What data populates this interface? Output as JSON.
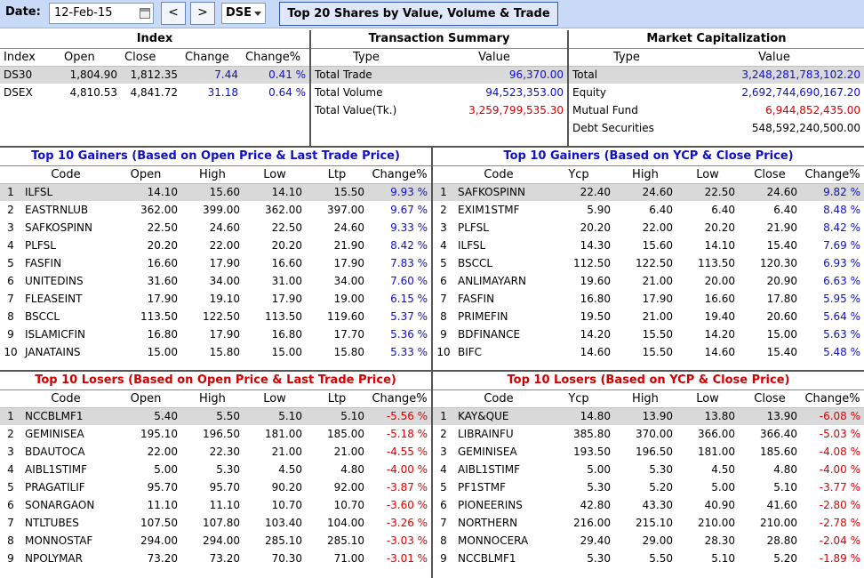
{
  "toolbar": {
    "date_label": "Date:",
    "date_value": "12-Feb-15",
    "prev_label": "<",
    "next_label": ">",
    "exchange": "DSE",
    "title": "Top 20 Shares by Value, Volume & Trade"
  },
  "index": {
    "title": "Index",
    "headers": [
      "Index",
      "Open",
      "Close",
      "Change",
      "Change%"
    ],
    "rows": [
      [
        "DS30",
        "1,804.90",
        "1,812.35",
        "7.44",
        "0.41 %"
      ],
      [
        "DSEX",
        "4,810.53",
        "4,841.72",
        "31.18",
        "0.64 %"
      ]
    ]
  },
  "transaction": {
    "title": "Transaction Summary",
    "headers": [
      "Type",
      "Value"
    ],
    "rows": [
      [
        "Total Trade",
        "96,370.00"
      ],
      [
        "Total Volume",
        "94,523,353.00"
      ],
      [
        "Total Value(Tk.)",
        "3,259,799,535.30"
      ]
    ]
  },
  "market_cap": {
    "title": "Market Capitalization",
    "headers": [
      "Type",
      "Value"
    ],
    "rows": [
      [
        "Total",
        "3,248,281,783,102.20"
      ],
      [
        "Equity",
        "2,692,744,690,167.20"
      ],
      [
        "Mutual Fund",
        "6,944,852,435.00"
      ],
      [
        "Debt Securities",
        "548,592,240,500.00"
      ]
    ]
  },
  "gainers_open": {
    "title": "Top 10 Gainers (Based on Open Price & Last Trade Price)",
    "headers": [
      "Code",
      "Open",
      "High",
      "Low",
      "Ltp",
      "Change%"
    ],
    "rows": [
      [
        "1",
        "ILFSL",
        "14.10",
        "15.60",
        "14.10",
        "15.50",
        "9.93 %"
      ],
      [
        "2",
        "EASTRNLUB",
        "362.00",
        "399.00",
        "362.00",
        "397.00",
        "9.67 %"
      ],
      [
        "3",
        "SAFKOSPINN",
        "22.50",
        "24.60",
        "22.50",
        "24.60",
        "9.33 %"
      ],
      [
        "4",
        "PLFSL",
        "20.20",
        "22.00",
        "20.20",
        "21.90",
        "8.42 %"
      ],
      [
        "5",
        "FASFIN",
        "16.60",
        "17.90",
        "16.60",
        "17.90",
        "7.83 %"
      ],
      [
        "6",
        "UNITEDINS",
        "31.60",
        "34.00",
        "31.00",
        "34.00",
        "7.60 %"
      ],
      [
        "7",
        "FLEASEINT",
        "17.90",
        "19.10",
        "17.90",
        "19.00",
        "6.15 %"
      ],
      [
        "8",
        "BSCCL",
        "113.50",
        "122.50",
        "113.50",
        "119.60",
        "5.37 %"
      ],
      [
        "9",
        "ISLAMICFIN",
        "16.80",
        "17.90",
        "16.80",
        "17.70",
        "5.36 %"
      ],
      [
        "10",
        "JANATAINS",
        "15.00",
        "15.80",
        "15.00",
        "15.80",
        "5.33 %"
      ]
    ]
  },
  "gainers_ycp": {
    "title": "Top 10 Gainers (Based on YCP & Close Price)",
    "headers": [
      "Code",
      "Ycp",
      "High",
      "Low",
      "Close",
      "Change%"
    ],
    "rows": [
      [
        "1",
        "SAFKOSPINN",
        "22.40",
        "24.60",
        "22.50",
        "24.60",
        "9.82 %"
      ],
      [
        "2",
        "EXIM1STMF",
        "5.90",
        "6.40",
        "6.40",
        "6.40",
        "8.48 %"
      ],
      [
        "3",
        "PLFSL",
        "20.20",
        "22.00",
        "20.20",
        "21.90",
        "8.42 %"
      ],
      [
        "4",
        "ILFSL",
        "14.30",
        "15.60",
        "14.10",
        "15.40",
        "7.69 %"
      ],
      [
        "5",
        "BSCCL",
        "112.50",
        "122.50",
        "113.50",
        "120.30",
        "6.93 %"
      ],
      [
        "6",
        "ANLIMAYARN",
        "19.60",
        "21.00",
        "20.00",
        "20.90",
        "6.63 %"
      ],
      [
        "7",
        "FASFIN",
        "16.80",
        "17.90",
        "16.60",
        "17.80",
        "5.95 %"
      ],
      [
        "8",
        "PRIMEFIN",
        "19.50",
        "21.00",
        "19.40",
        "20.60",
        "5.64 %"
      ],
      [
        "9",
        "BDFINANCE",
        "14.20",
        "15.50",
        "14.20",
        "15.00",
        "5.63 %"
      ],
      [
        "10",
        "BIFC",
        "14.60",
        "15.50",
        "14.60",
        "15.40",
        "5.48 %"
      ]
    ]
  },
  "losers_open": {
    "title": "Top 10 Losers (Based on Open Price & Last Trade Price)",
    "headers": [
      "Code",
      "Open",
      "High",
      "Low",
      "Ltp",
      "Change%"
    ],
    "rows": [
      [
        "1",
        "NCCBLMF1",
        "5.40",
        "5.50",
        "5.10",
        "5.10",
        "-5.56 %"
      ],
      [
        "2",
        "GEMINISEA",
        "195.10",
        "196.50",
        "181.00",
        "185.00",
        "-5.18 %"
      ],
      [
        "3",
        "BDAUTOCA",
        "22.00",
        "22.30",
        "21.00",
        "21.00",
        "-4.55 %"
      ],
      [
        "4",
        "AIBL1STIMF",
        "5.00",
        "5.30",
        "4.50",
        "4.80",
        "-4.00 %"
      ],
      [
        "5",
        "PRAGATILIF",
        "95.70",
        "95.70",
        "90.20",
        "92.00",
        "-3.87 %"
      ],
      [
        "6",
        "SONARGAON",
        "11.10",
        "11.10",
        "10.70",
        "10.70",
        "-3.60 %"
      ],
      [
        "7",
        "NTLTUBES",
        "107.50",
        "107.80",
        "103.40",
        "104.00",
        "-3.26 %"
      ],
      [
        "8",
        "MONNOSTAF",
        "294.00",
        "294.00",
        "285.10",
        "285.10",
        "-3.03 %"
      ],
      [
        "9",
        "NPOLYMAR",
        "73.20",
        "73.20",
        "70.30",
        "71.00",
        "-3.01 %"
      ]
    ]
  },
  "losers_ycp": {
    "title": "Top 10 Losers (Based on YCP & Close Price)",
    "headers": [
      "Code",
      "Ycp",
      "High",
      "Low",
      "Close",
      "Change%"
    ],
    "rows": [
      [
        "1",
        "KAY&QUE",
        "14.80",
        "13.90",
        "13.80",
        "13.90",
        "-6.08 %"
      ],
      [
        "2",
        "LIBRAINFU",
        "385.80",
        "370.00",
        "366.00",
        "366.40",
        "-5.03 %"
      ],
      [
        "3",
        "GEMINISEA",
        "193.50",
        "196.50",
        "181.00",
        "185.60",
        "-4.08 %"
      ],
      [
        "4",
        "AIBL1STIMF",
        "5.00",
        "5.30",
        "4.50",
        "4.80",
        "-4.00 %"
      ],
      [
        "5",
        "PF1STMF",
        "5.30",
        "5.20",
        "5.00",
        "5.10",
        "-3.77 %"
      ],
      [
        "6",
        "PIONEERINS",
        "42.80",
        "43.30",
        "40.90",
        "41.60",
        "-2.80 %"
      ],
      [
        "7",
        "NORTHERN",
        "216.00",
        "215.10",
        "210.00",
        "210.00",
        "-2.78 %"
      ],
      [
        "8",
        "MONNOCERA",
        "29.40",
        "29.00",
        "28.30",
        "28.80",
        "-2.04 %"
      ],
      [
        "9",
        "NCCBLMF1",
        "5.30",
        "5.50",
        "5.10",
        "5.20",
        "-1.89 %"
      ]
    ]
  },
  "colors": {
    "positive": "#1010c8",
    "negative": "#e00000",
    "highlight": "#d9d9d9"
  }
}
